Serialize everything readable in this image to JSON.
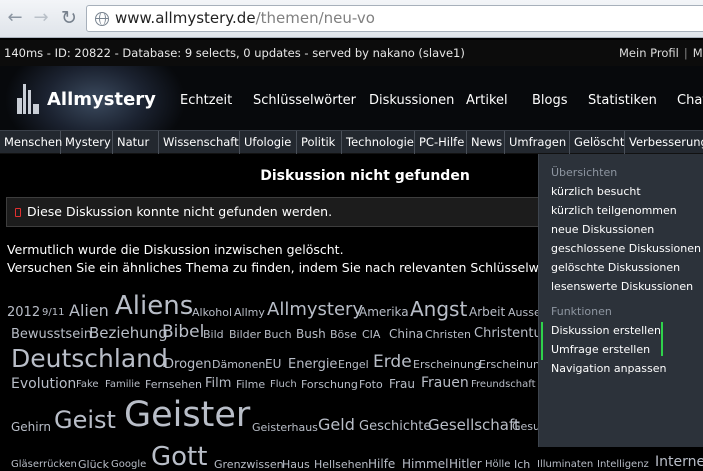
{
  "browser": {
    "url_host": "www.allmystery.de",
    "url_path": "/themen/neu-vo"
  },
  "status": {
    "debug": "140ms - ID: 20822 - Database: 9 selects, 0 updates - served by nakano (slave1)",
    "profile_link": "Mein Profil",
    "sep": "|",
    "more_link": "Mei"
  },
  "header": {
    "logo": "Allmystery",
    "nav": [
      "Echtzeit",
      "Schlüsselwörter",
      "Diskussionen",
      "Artikel",
      "Blogs",
      "Statistiken",
      "Chat"
    ]
  },
  "categories": [
    "Menschen",
    "Mystery",
    "Natur",
    "Wissenschaft",
    "Ufologie",
    "Politik",
    "Technologie",
    "PC-Hilfe",
    "News",
    "Umfragen",
    "Gelöscht",
    "Verbesserungen"
  ],
  "main": {
    "heading": "Diskussion nicht gefunden",
    "error": "Diese Diskussion konnte nicht gefunden werden.",
    "line1": "Vermutlich wurde die Diskussion inzwischen gelöscht.",
    "line2": "Versuchen Sie ein ähnliches Thema zu finden, indem Sie nach relevanten Schlüsselwörtern s"
  },
  "tags": [
    "2012",
    "9/11",
    "Alien",
    "Aliens",
    "Alkohol",
    "Allmy",
    "Allmystery",
    "Amerika",
    "Angst",
    "Arbeit",
    "Ausse",
    "Bewusstsein",
    "Beziehung",
    "Bibel",
    "Bild",
    "Bilder",
    "Buch",
    "Bush",
    "Böse",
    "CIA",
    "China",
    "Christen",
    "Christentur",
    "Deutschland",
    "Drogen",
    "Dämonen",
    "EU",
    "Energie",
    "Engel",
    "Erde",
    "Erscheinung",
    "Erscheinung",
    "Evolution",
    "Fake",
    "Familie",
    "Fernsehen",
    "Film",
    "Filme",
    "Fluch",
    "Forschung",
    "Foto",
    "Frau",
    "Frauen",
    "Freundschaft",
    "Gehirn",
    "Geist",
    "Geister",
    "Geisterhaus",
    "Geld",
    "Geschichte",
    "Gesellschaft",
    "Gesu",
    "Gläserrücken",
    "Glück",
    "Google",
    "Gott",
    "Grenzwissen",
    "Haus",
    "Hellsehen",
    "Hilfe",
    "Himmel",
    "Hitler",
    "Hölle",
    "Ich",
    "Illuminaten",
    "Intelligenz",
    "Interne"
  ],
  "dropdown": {
    "title_overview": "Übersichten",
    "overview": [
      "kürzlich besucht",
      "kürzlich teilgenommen",
      "neue Diskussionen",
      "geschlossene Diskussionen",
      "gelöschte Diskussionen",
      "lesenswerte Diskussionen"
    ],
    "title_functions": "Funktionen",
    "functions": [
      "Diskussion erstellen",
      "Umfrage erstellen",
      "Navigation anpassen"
    ]
  },
  "colors": {
    "accent_green": "#2fd24b",
    "error_red": "#e03030"
  }
}
